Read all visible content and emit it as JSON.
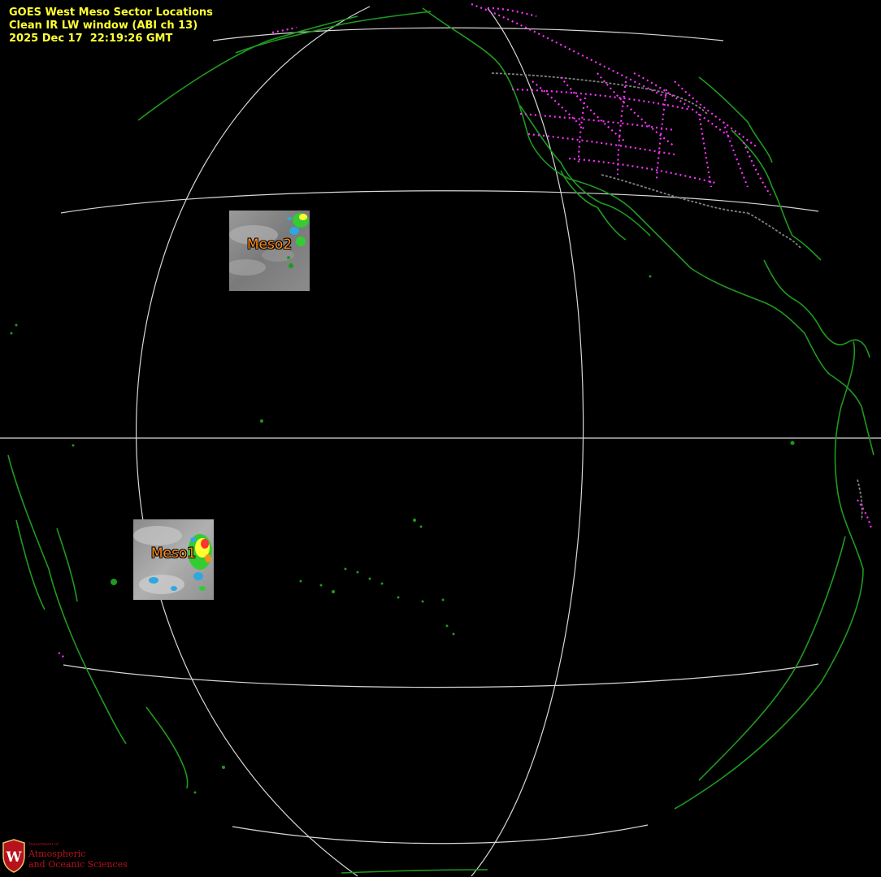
{
  "header": {
    "line1": "GOES West Meso Sector Locations",
    "line2": "Clean IR LW window (ABI ch 13)",
    "line3": "2025 Dec 17  22:19:26 GMT"
  },
  "sectors": [
    {
      "id": "meso1",
      "label": "Meso1"
    },
    {
      "id": "meso2",
      "label": "Meso2"
    }
  ],
  "logo": {
    "dept_label": "Department of",
    "name_line1": "Atmospheric",
    "name_line2": "and Oceanic Sciences",
    "brand_color": "#b5121b"
  },
  "colors": {
    "background": "#000000",
    "coastline": "#1f9a1f",
    "state_borders": "#ff33ff",
    "country_borders": "#808080",
    "graticule": "#d8d8d8",
    "title_text": "#ffff33",
    "sector_label": "#ff8c1a"
  }
}
